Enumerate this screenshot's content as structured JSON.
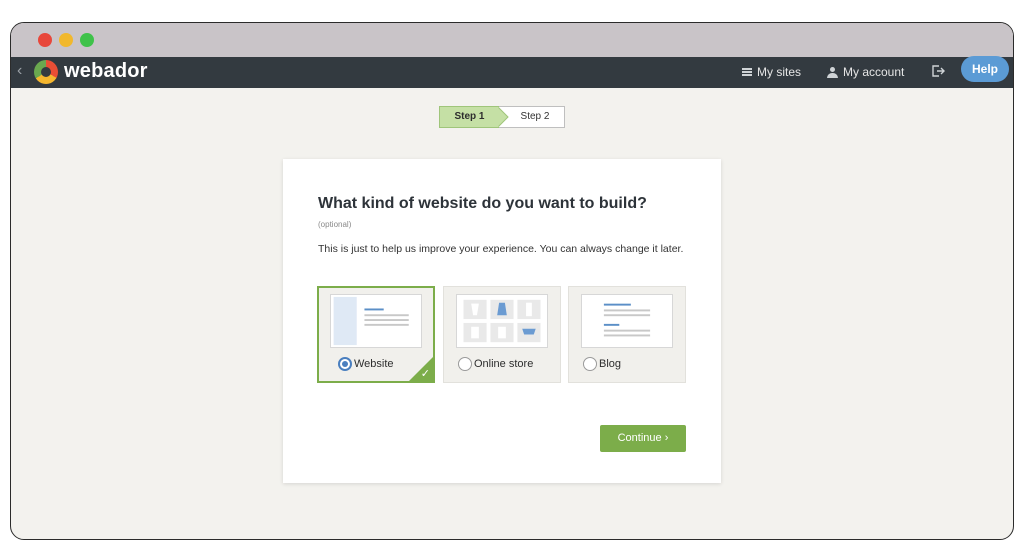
{
  "navbar": {
    "logo_text": "webador",
    "my_sites": "My sites",
    "my_account": "My account",
    "help": "Help",
    "back_glyph": "‹",
    "logout_icon": "logout-icon"
  },
  "steps": {
    "step1": "Step 1",
    "step2": "Step 2"
  },
  "card": {
    "question": "What kind of website do you want to build?",
    "optional": "(optional)",
    "description": "This is just to help us improve your experience. You can always change it later.",
    "options": [
      {
        "label": "Website",
        "selected": true
      },
      {
        "label": "Online store",
        "selected": false
      },
      {
        "label": "Blog",
        "selected": false
      }
    ],
    "continue_label": "Continue ›"
  },
  "colors": {
    "accent_green": "#7cad4a",
    "help_blue": "#5b9bd5",
    "navbar": "#333a40"
  }
}
